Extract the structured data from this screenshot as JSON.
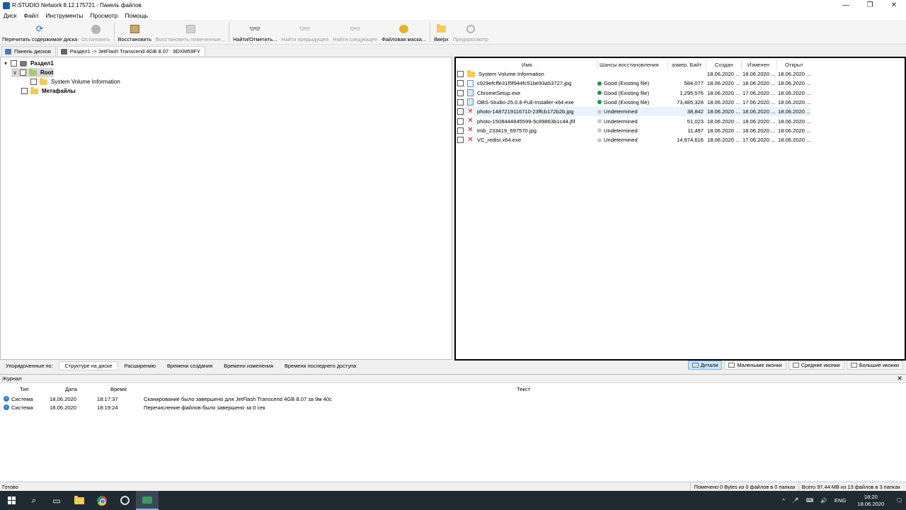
{
  "window": {
    "title": "R-STUDIO Network 8.12.175721 - Панель файлов",
    "controls": [
      "—",
      "❐",
      "✕"
    ]
  },
  "menu": [
    "Диск",
    "Файл",
    "Инструменты",
    "Просмотр",
    "Помощь"
  ],
  "toolbar": [
    {
      "label": "Перечитать содержимое диска",
      "icon": "refresh-icon",
      "enabled": true
    },
    {
      "label": "Остановить",
      "icon": "stop-icon",
      "enabled": false
    },
    {
      "label": "Восстановить",
      "icon": "recover-icon",
      "enabled": true
    },
    {
      "label": "Восстановить помеченные...",
      "icon": "recover-marked-icon",
      "enabled": false
    },
    {
      "label": "Найти/Отметить...",
      "icon": "find-icon",
      "enabled": true
    },
    {
      "label": "Найти предыдущее",
      "icon": "find-prev-icon",
      "enabled": false
    },
    {
      "label": "Найти следующее",
      "icon": "find-next-icon",
      "enabled": false
    },
    {
      "label": "Файловая маска...",
      "icon": "file-mask-icon",
      "enabled": true
    },
    {
      "label": "Вверх",
      "icon": "up-folder-icon",
      "enabled": true
    },
    {
      "label": "Предпросмотр",
      "icon": "preview-icon",
      "enabled": false
    }
  ],
  "tabs": [
    {
      "label": "Панель дисков",
      "active": false
    },
    {
      "label": "Раздел1 -> JetFlash Transcend 4GB 8.07 : 9DXM59FY",
      "active": true
    }
  ],
  "tree": {
    "partition": "Раздел1",
    "root": "Root",
    "child": "System Volume Information",
    "metafiles": "Метафайлы",
    "expand_glyph": "▾",
    "expand_glyph2": "∨"
  },
  "files": {
    "columns": [
      "Имя",
      "Шансы восстановления",
      "азмер, Байт",
      "Создан",
      "Изменен",
      "Открыт"
    ],
    "rows": [
      {
        "name": "System Volume Information",
        "type": "folder",
        "chance": "",
        "chance_class": "",
        "size": "",
        "created": "18.06.2020 ...",
        "modified": "18.06.2020 ...",
        "accessed": "18.06.2020 ..."
      },
      {
        "name": "c929efcffe31f5f944fc51be93a53727.jpg",
        "type": "img",
        "chance": "Good (Existing file)",
        "chance_class": "good",
        "size": "584,077",
        "created": "18.06.2020 ...",
        "modified": "18.06.2020 ...",
        "accessed": "18.06.2020 ..."
      },
      {
        "name": "ChromeSetup.exe",
        "type": "exe",
        "chance": "Good (Existing file)",
        "chance_class": "good",
        "size": "1,295,576",
        "created": "18.06.2020 ...",
        "modified": "17.06.2020 ...",
        "accessed": "18.06.2020 ..."
      },
      {
        "name": "OBS-Studio-25.0.8-Full-Installer-x64.exe",
        "type": "exe",
        "chance": "Good (Existing file)",
        "chance_class": "good",
        "size": "73,485,328",
        "created": "18.06.2020 ...",
        "modified": "17.06.2020 ...",
        "accessed": "18.06.2020 ..."
      },
      {
        "name": "photo-1487219116710-23ffcb172b2b.jpg",
        "type": "bad",
        "chance": "Undetermined",
        "chance_class": "undet",
        "size": "38,842",
        "created": "18.06.2020 ...",
        "modified": "18.06.2020 ...",
        "accessed": "18.06.2020 ..."
      },
      {
        "name": "photo-1508444845599-5c89863b1c44.jfif",
        "type": "bad",
        "chance": "Undetermined",
        "chance_class": "undet",
        "size": "51,023",
        "created": "18.06.2020 ...",
        "modified": "18.06.2020 ...",
        "accessed": "18.06.2020 ..."
      },
      {
        "name": "tmb_233419_697570.jpg",
        "type": "bad",
        "chance": "Undetermined",
        "chance_class": "undet",
        "size": "11,497",
        "created": "18.06.2020 ...",
        "modified": "18.06.2020 ...",
        "accessed": "18.06.2020 ..."
      },
      {
        "name": "VC_redist.x64.exe",
        "type": "bad",
        "chance": "Undetermined",
        "chance_class": "undet",
        "size": "14,974,616",
        "created": "18.06.2020 ...",
        "modified": "17.06.2020 ...",
        "accessed": "18.06.2020 ..."
      }
    ]
  },
  "sortbar": {
    "prefix": "Упорядоченные по:",
    "options": [
      "Структуре на диске",
      "Расширению",
      "Времени создания",
      "Времени изменения",
      "Времени последнего доступа"
    ],
    "view_modes": [
      "Детали",
      "Маленькие иконки",
      "Средние иконки",
      "Большие иконки"
    ]
  },
  "log": {
    "title": "Журнал",
    "close": "✕",
    "columns": [
      "Тип",
      "Дата",
      "Время",
      "Текст"
    ],
    "rows": [
      {
        "type": "Система",
        "date": "18.06.2020",
        "time": "18:17:37",
        "text": "Сканирование было завершено для JetFlash Transcend 4GB 8.07 за 9м 40с"
      },
      {
        "type": "Система",
        "date": "18.06.2020",
        "time": "18:19:24",
        "text": "Перечисление файлов было завершено за 0 сек"
      }
    ]
  },
  "status": {
    "ready": "Готово",
    "marked": "Помечено 0 Bytes из 0 файлов в 0 папках",
    "total": "Всего 97.44 MB из 13 файлов в 3 папках"
  },
  "taskbar": {
    "tray": [
      "^",
      "🎤",
      "⌨",
      "🔊",
      "ENG"
    ],
    "time": "18:20",
    "date": "18.06.2020",
    "notify": "🗨"
  },
  "colors": {
    "accent": "#7fb4e6",
    "good": "#1a9a43",
    "bad": "#d0141a",
    "folder": "#f3cc57"
  }
}
